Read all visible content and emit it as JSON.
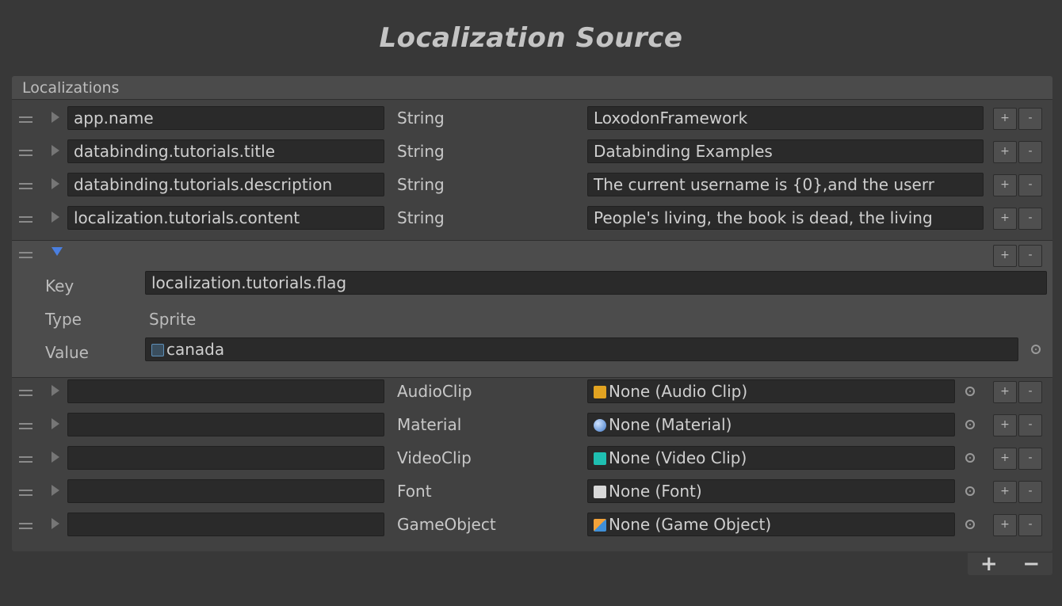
{
  "title": "Localization Source",
  "section_label": "Localizations",
  "rows_top": [
    {
      "key": "app.name",
      "type": "String",
      "value": "LoxodonFramework"
    },
    {
      "key": "databinding.tutorials.title",
      "type": "String",
      "value": "Databinding Examples"
    },
    {
      "key": "databinding.tutorials.description",
      "type": "String",
      "value": "The current username is {0},and the userr"
    },
    {
      "key": "localization.tutorials.content",
      "type": "String",
      "value": "People's living, the book is dead, the living"
    }
  ],
  "expanded": {
    "key_label": "Key",
    "key_value": "localization.tutorials.flag",
    "type_label": "Type",
    "type_value": "Sprite",
    "value_label": "Value",
    "value_value": "canada"
  },
  "rows_bottom": [
    {
      "key": "",
      "type": "AudioClip",
      "value": "None (Audio Clip)",
      "icon": "audio-clip-icon"
    },
    {
      "key": "",
      "type": "Material",
      "value": "None (Material)",
      "icon": "material-icon"
    },
    {
      "key": "",
      "type": "VideoClip",
      "value": "None (Video Clip)",
      "icon": "video-clip-icon"
    },
    {
      "key": "",
      "type": "Font",
      "value": "None (Font)",
      "icon": "font-icon"
    },
    {
      "key": "",
      "type": "GameObject",
      "value": "None (Game Object)",
      "icon": "game-object-icon"
    }
  ],
  "buttons": {
    "plus": "+",
    "minus": "-",
    "footer_plus": "+",
    "footer_minus": "−"
  }
}
